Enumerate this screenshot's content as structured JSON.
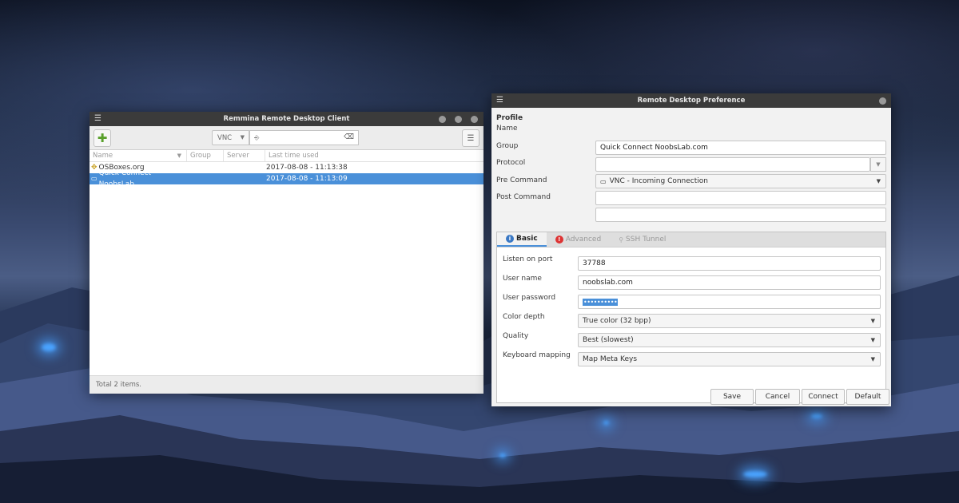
{
  "main_window": {
    "title": "Remmina Remote Desktop Client",
    "protocol_value": "VNC",
    "columns": [
      "Name",
      "Group",
      "Server",
      "Last time used"
    ],
    "rows": [
      {
        "name": "OSBoxes.org",
        "group": "",
        "server": "",
        "last_used": "2017-08-08 - 11:13:38",
        "selected": false
      },
      {
        "name": "Quick Connect NoobsLab",
        "group": "",
        "server": "",
        "last_used": "2017-08-08 - 11:13:09",
        "selected": true
      }
    ],
    "status": "Total 2 items."
  },
  "pref_window": {
    "title": "Remote Desktop Preference",
    "section": "Profile",
    "name_label": "Name",
    "name_value": "Quick Connect NoobsLab.com",
    "group_label": "Group",
    "group_value": "",
    "protocol_label": "Protocol",
    "protocol_value": "VNC - Incoming Connection",
    "pre_command_label": "Pre Command",
    "post_command_label": "Post Command",
    "tabs": [
      "Basic",
      "Advanced",
      "SSH Tunnel"
    ],
    "basic": {
      "port_label": "Listen on port",
      "port_value": "37788",
      "user_label": "User name",
      "user_value": "noobslab.com",
      "password_label": "User password",
      "password_value": "••••••••••",
      "color_label": "Color depth",
      "color_value": "True color (32 bpp)",
      "quality_label": "Quality",
      "quality_value": "Best (slowest)",
      "keyboard_label": "Keyboard mapping",
      "keyboard_value": "Map Meta Keys"
    },
    "buttons": {
      "save": "Save",
      "cancel": "Cancel",
      "connect": "Connect",
      "default": "Default"
    }
  },
  "colors": {
    "accent": "#4a90d9",
    "titlebar": "#3b3b3b"
  }
}
